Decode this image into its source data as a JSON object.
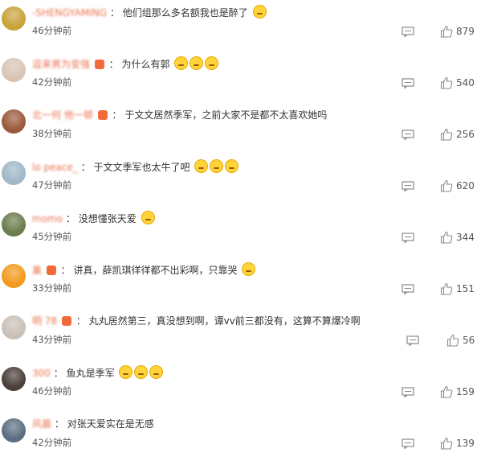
{
  "comments": [
    {
      "user": "-SHENGYAMING",
      "text": "他们组那么多名额我也是醉了",
      "emojis": 1,
      "badge": false,
      "time": "46分钟前",
      "likes": "879",
      "avatar_color": "#c8a33a"
    },
    {
      "user": "逗来男为变强",
      "text": "为什么有郭",
      "emojis": 3,
      "badge": true,
      "time": "42分钟前",
      "likes": "540",
      "avatar_color": "#d9c4b3"
    },
    {
      "user": "北一何 他一顿",
      "text": "于文文居然季军，之前大家不是都不太喜欢她吗",
      "emojis": 0,
      "badge": true,
      "time": "38分钟前",
      "likes": "256",
      "avatar_color": "#9b5a3c"
    },
    {
      "user": "lo peace_",
      "text": "于文文季军也太牛了吧",
      "emojis": 3,
      "badge": false,
      "time": "47分钟前",
      "likes": "620",
      "avatar_color": "#a0b8c8"
    },
    {
      "user": "momo",
      "text": "没想懂张天爱",
      "emojis": 1,
      "badge": false,
      "time": "45分钟前",
      "likes": "344",
      "avatar_color": "#6b7d4e"
    },
    {
      "user": "巢",
      "text": "讲真，薛凯琪徉徉都不出彩啊，只靠哭",
      "emojis": 1,
      "badge": true,
      "time": "33分钟前",
      "likes": "151",
      "avatar_color": "#f29a1d"
    },
    {
      "user": "明 78",
      "text": "丸丸居然第三，真没想到啊，谭vv前三都没有，这算不算爆冷啊",
      "emojis": 0,
      "badge": true,
      "time": "43分钟前",
      "likes": "56",
      "avatar_color": "#c9c0b7"
    },
    {
      "user": "300",
      "text": "鱼丸是季军",
      "emojis": 3,
      "badge": false,
      "time": "46分钟前",
      "likes": "159",
      "avatar_color": "#4a3f3a"
    },
    {
      "user": "风晨",
      "text": "对张天爱实在是无感",
      "emojis": 0,
      "badge": false,
      "time": "42分钟前",
      "likes": "139",
      "avatar_color": "#5b6f82"
    }
  ]
}
